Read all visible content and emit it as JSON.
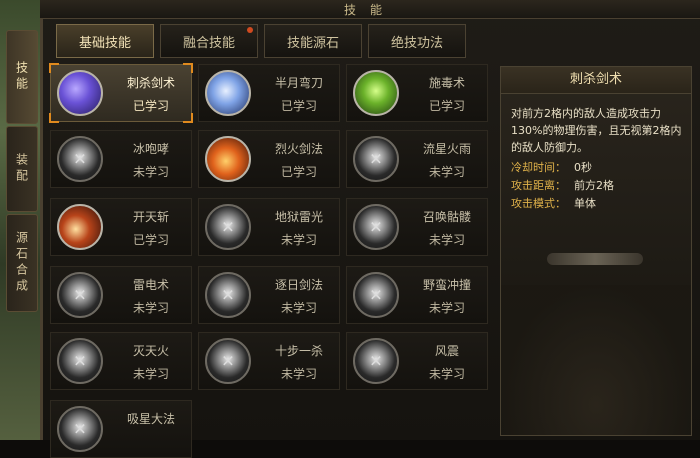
{
  "window": {
    "title": "技能"
  },
  "side_tabs": [
    {
      "label": "技能",
      "active": true
    },
    {
      "label": "装配",
      "active": false
    },
    {
      "label": "源石合成",
      "active": false
    }
  ],
  "tabs": [
    {
      "label": "基础技能",
      "active": true,
      "notify": false
    },
    {
      "label": "融合技能",
      "active": false,
      "notify": true
    },
    {
      "label": "技能源石",
      "active": false,
      "notify": false
    },
    {
      "label": "绝技功法",
      "active": false,
      "notify": false
    }
  ],
  "skills": [
    {
      "name": "刺杀剑术",
      "status": "已学习",
      "icon": "sword-slash-icon",
      "learned": true,
      "selected": true
    },
    {
      "name": "半月弯刀",
      "status": "已学习",
      "icon": "crescent-blade-icon",
      "learned": true,
      "selected": false
    },
    {
      "name": "施毒术",
      "status": "已学习",
      "icon": "poison-skull-icon",
      "learned": true,
      "selected": false
    },
    {
      "name": "冰咆哮",
      "status": "未学习",
      "icon": "locked-skill-icon",
      "learned": false,
      "selected": false
    },
    {
      "name": "烈火剑法",
      "status": "已学习",
      "icon": "flame-sword-icon",
      "learned": true,
      "selected": false
    },
    {
      "name": "流星火雨",
      "status": "未学习",
      "icon": "locked-skill-icon",
      "learned": false,
      "selected": false
    },
    {
      "name": "开天斩",
      "status": "已学习",
      "icon": "heaven-cleave-icon",
      "learned": true,
      "selected": false
    },
    {
      "name": "地狱雷光",
      "status": "未学习",
      "icon": "locked-skill-icon",
      "learned": false,
      "selected": false
    },
    {
      "name": "召唤骷髅",
      "status": "未学习",
      "icon": "locked-skill-icon",
      "learned": false,
      "selected": false
    },
    {
      "name": "雷电术",
      "status": "未学习",
      "icon": "locked-skill-icon",
      "learned": false,
      "selected": false
    },
    {
      "name": "逐日剑法",
      "status": "未学习",
      "icon": "locked-skill-icon",
      "learned": false,
      "selected": false
    },
    {
      "name": "野蛮冲撞",
      "status": "未学习",
      "icon": "locked-skill-icon",
      "learned": false,
      "selected": false
    },
    {
      "name": "灭天火",
      "status": "未学习",
      "icon": "locked-skill-icon",
      "learned": false,
      "selected": false
    },
    {
      "name": "十步一杀",
      "status": "未学习",
      "icon": "locked-skill-icon",
      "learned": false,
      "selected": false
    },
    {
      "name": "风震",
      "status": "未学习",
      "icon": "locked-skill-icon",
      "learned": false,
      "selected": false
    },
    {
      "name": "吸星大法",
      "status": "",
      "icon": "locked-skill-icon",
      "learned": false,
      "selected": false
    }
  ],
  "detail": {
    "title": "刺杀剑术",
    "description": "对前方2格内的敌人造成攻击力130%的物理伤害，且无视第2格内的敌人防御力。",
    "attributes": [
      {
        "label": "冷却时间：",
        "value": "0秒"
      },
      {
        "label": "攻击距离：",
        "value": "前方2格"
      },
      {
        "label": "攻击模式：",
        "value": "单体"
      }
    ]
  },
  "colors": {
    "selection": "#e08a1e",
    "attr_label": "#e0b24a",
    "title_text": "#c9b98a"
  }
}
